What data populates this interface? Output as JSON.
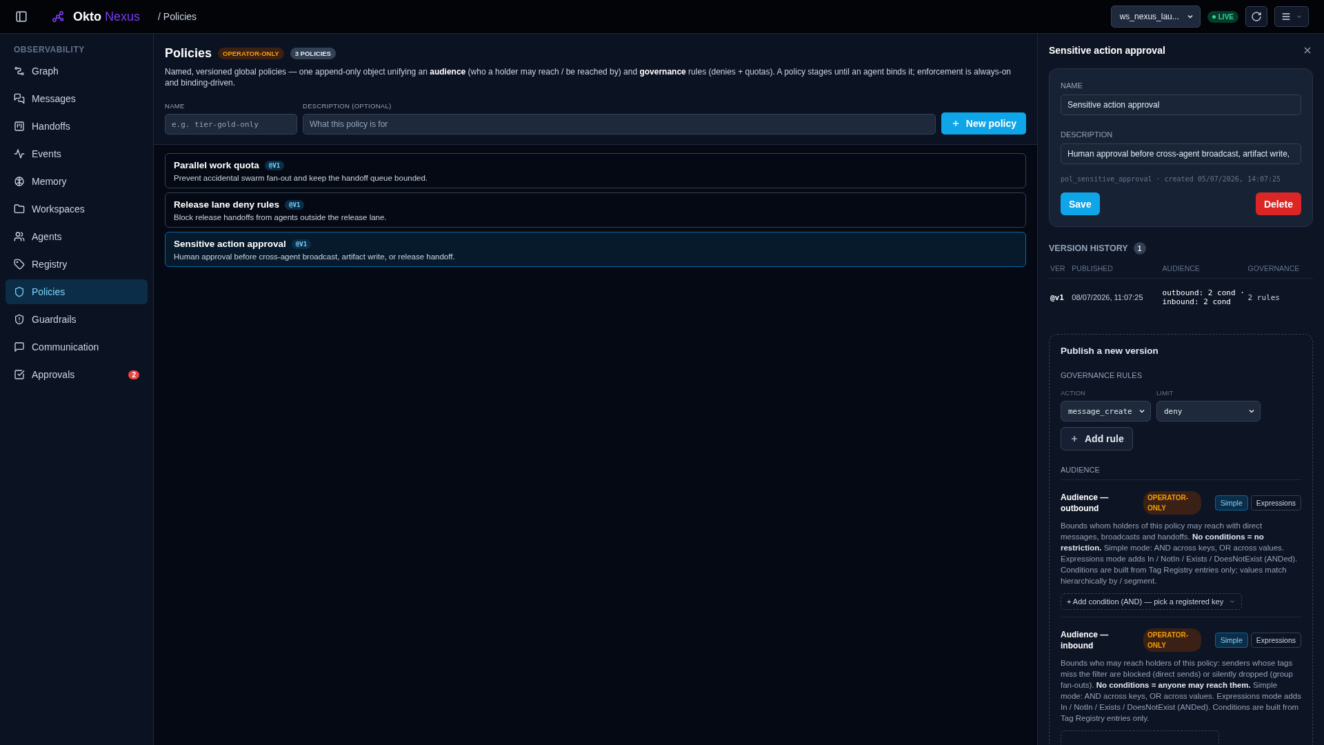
{
  "topbar": {
    "brand_first": "Okto",
    "brand_second": "Nexus",
    "breadcrumb": "/ Policies",
    "workspace": "ws_nexus_lau...",
    "live": "LIVE"
  },
  "sidebar": {
    "section": "OBSERVABILITY",
    "items": [
      {
        "label": "Graph",
        "selected": false
      },
      {
        "label": "Messages",
        "selected": false
      },
      {
        "label": "Handoffs",
        "selected": false
      },
      {
        "label": "Events",
        "selected": false
      },
      {
        "label": "Memory",
        "selected": false
      },
      {
        "label": "Workspaces",
        "selected": false
      },
      {
        "label": "Agents",
        "selected": false
      },
      {
        "label": "Registry",
        "selected": false
      },
      {
        "label": "Policies",
        "selected": true
      },
      {
        "label": "Guardrails",
        "selected": false
      },
      {
        "label": "Communication",
        "selected": false
      },
      {
        "label": "Approvals",
        "selected": false,
        "badge": "2"
      }
    ]
  },
  "main": {
    "title": "Policies",
    "badges": [
      {
        "label": "OPERATOR-ONLY",
        "kind": "warning"
      },
      {
        "label": "3 POLICIES",
        "kind": "neutral"
      }
    ],
    "description": "Named, versioned global policies — one append-only object unifying an **audience** (who a holder may reach / be reached by) and **governance** rules (denies + quotas). A policy stages until an agent binds it; enforcement is always-on and binding-driven.",
    "form": {
      "name_label": "NAME",
      "name_placeholder": "e.g. tier-gold-only",
      "description_label": "DESCRIPTION (OPTIONAL)",
      "description_placeholder": "What this policy is for",
      "button": "New policy"
    },
    "policies": [
      {
        "name": "Parallel work quota",
        "version": "@V1",
        "description": "Prevent accidental swarm fan-out and keep the handoff queue bounded.",
        "selected": false
      },
      {
        "name": "Release lane deny rules",
        "version": "@V1",
        "description": "Block release handoffs from agents outside the release lane.",
        "selected": false
      },
      {
        "name": "Sensitive action approval",
        "version": "@V1",
        "description": "Human approval before cross-agent broadcast, artifact write, or release handoff.",
        "selected": true
      }
    ]
  },
  "panel": {
    "title": "Sensitive action approval",
    "card": {
      "name_label": "NAME",
      "name_value": "Sensitive action approval",
      "description_label": "DESCRIPTION",
      "description_value": "Human approval before cross-agent broadcast, artifact write,",
      "meta": "pol_sensitive_approval · created 05/07/2026, 14:07:25",
      "save": "Save",
      "delete": "Delete"
    },
    "history": {
      "title": "VERSION HISTORY",
      "count": "1",
      "columns": [
        "VER",
        "PUBLISHED",
        "AUDIENCE",
        "GOVERNANCE"
      ],
      "rows": [
        {
          "ver": "@v1",
          "published": "08/07/2026, 11:07:25",
          "audience": "outbound: 2 cond · inbound: 2 cond",
          "governance": "2 rules"
        }
      ]
    },
    "publish": {
      "title": "Publish a new version",
      "governance_label": "GOVERNANCE RULES",
      "action_label": "ACTION",
      "limit_label": "LIMIT",
      "action_value": "message_create",
      "limit_value": "deny",
      "add_rule": "Add rule",
      "audience_label": "AUDIENCE",
      "audiences": [
        {
          "title": "Audience — outbound",
          "badge": "OPERATOR-ONLY",
          "modes": [
            {
              "label": "Simple",
              "selected": true
            },
            {
              "label": "Expressions",
              "selected": false
            }
          ],
          "description": "Bounds whom holders of this policy may reach with direct messages, broadcasts and handoffs. **No conditions = no restriction.** Simple mode: AND across keys, OR across values. Expressions mode adds In / NotIn / Exists / DoesNotExist (ANDed). Conditions are built from Tag Registry entries only; values match hierarchically by / segment.",
          "add_condition": "+ Add condition (AND) — pick a registered key"
        },
        {
          "title": "Audience — inbound",
          "badge": "OPERATOR-ONLY",
          "modes": [
            {
              "label": "Simple",
              "selected": true
            },
            {
              "label": "Expressions",
              "selected": false
            }
          ],
          "description": "Bounds who may reach holders of this policy: senders whose tags miss the filter are blocked (direct sends) or silently dropped (group fan-outs). **No conditions = anyone may reach them.** Simple mode: AND across keys, OR across values. Expressions mode adds In / NotIn / Exists / DoesNotExist (ANDed). Conditions are built from Tag Registry entries only."
        }
      ]
    }
  }
}
